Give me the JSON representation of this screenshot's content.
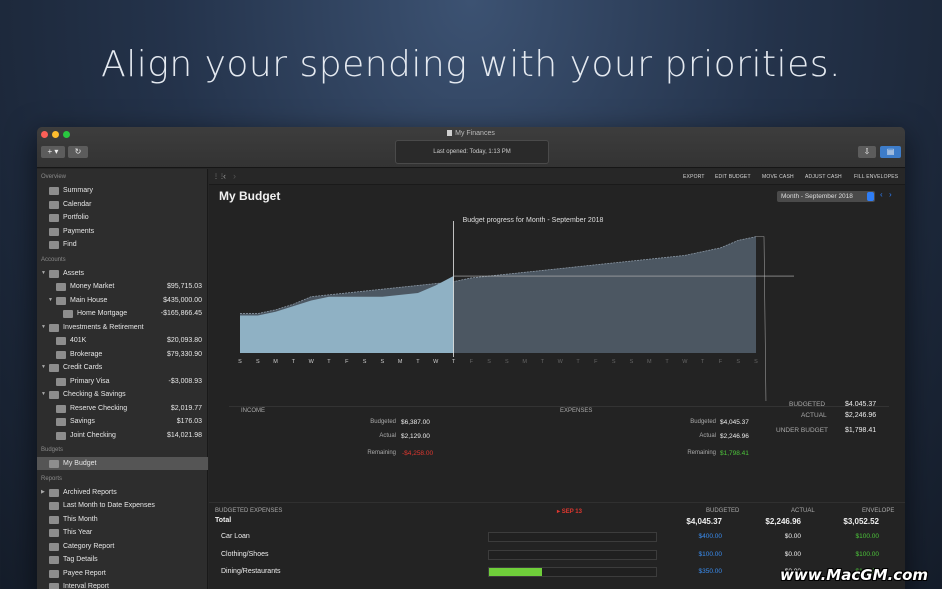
{
  "headline": "Align your spending with your priorities.",
  "window": {
    "title": "My Finances",
    "last_opened": "Last opened: Today, 1:13 PM",
    "add_button": "+ ▾",
    "refresh_button": "↻"
  },
  "sidebar": {
    "overview_label": "Overview",
    "overview": [
      {
        "label": "Summary",
        "icon": "summary-icon"
      },
      {
        "label": "Calendar",
        "icon": "calendar-icon"
      },
      {
        "label": "Portfolio",
        "icon": "portfolio-icon"
      },
      {
        "label": "Payments",
        "icon": "payments-icon"
      },
      {
        "label": "Find",
        "icon": "find-icon"
      }
    ],
    "accounts_label": "Accounts",
    "accounts": [
      {
        "label": "Assets",
        "amount": "",
        "indent": 1,
        "group": true
      },
      {
        "label": "Money Market",
        "amount": "$95,715.03",
        "indent": 2
      },
      {
        "label": "Main House",
        "amount": "$435,000.00",
        "indent": 2,
        "group": true
      },
      {
        "label": "Home Mortgage",
        "amount": "-$165,866.45",
        "indent": 3
      },
      {
        "label": "Investments & Retirement",
        "amount": "",
        "indent": 1,
        "group": true
      },
      {
        "label": "401K",
        "amount": "$20,093.80",
        "indent": 2
      },
      {
        "label": "Brokerage",
        "amount": "$79,330.90",
        "indent": 2
      },
      {
        "label": "Credit Cards",
        "amount": "",
        "indent": 1,
        "group": true
      },
      {
        "label": "Primary Visa",
        "amount": "-$3,008.93",
        "indent": 2
      },
      {
        "label": "Checking & Savings",
        "amount": "",
        "indent": 1,
        "group": true
      },
      {
        "label": "Reserve Checking",
        "amount": "$2,019.77",
        "indent": 2
      },
      {
        "label": "Savings",
        "amount": "$176.03",
        "indent": 2
      },
      {
        "label": "Joint Checking",
        "amount": "$14,021.98",
        "indent": 2
      }
    ],
    "budgets_label": "Budgets",
    "budgets": [
      {
        "label": "My Budget"
      }
    ],
    "reports_label": "Reports",
    "reports": [
      {
        "label": "Archived Reports",
        "group": true
      },
      {
        "label": "Last Month to Date Expenses"
      },
      {
        "label": "This Month"
      },
      {
        "label": "This Year"
      },
      {
        "label": "Category Report"
      },
      {
        "label": "Tag Details"
      },
      {
        "label": "Payee Report"
      },
      {
        "label": "Interval Report"
      }
    ]
  },
  "toolbar": {
    "export": "EXPORT",
    "edit_budget": "EDIT BUDGET",
    "move_cash": "MOVE CASH",
    "adjust_cash": "ADJUST CASH",
    "fill_envelopes": "FILL ENVELOPES"
  },
  "budget": {
    "title": "My Budget",
    "period": "Month - September 2018",
    "summary": {
      "budgeted_label": "BUDGETED",
      "budgeted": "$4,045.37",
      "actual_label": "ACTUAL",
      "actual": "$2,246.96",
      "under_label": "UNDER BUDGET",
      "under": "$1,798.41"
    },
    "income": {
      "label": "INCOME",
      "budgeted_label": "Budgeted",
      "budgeted": "$6,387.00",
      "actual_label": "Actual",
      "actual": "$2,129.00",
      "remaining_label": "Remaining",
      "remaining": "-$4,258.00"
    },
    "expenses": {
      "label": "EXPENSES",
      "budgeted_label": "Budgeted",
      "budgeted": "$4,045.37",
      "actual_label": "Actual",
      "actual": "$2,246.96",
      "remaining_label": "Remaining",
      "remaining": "$1,798.41"
    },
    "table": {
      "header": "BUDGETED EXPENSES",
      "date_marker": "SEP 13",
      "col_budgeted": "BUDGETED",
      "col_actual": "ACTUAL",
      "col_envelope": "ENVELOPE",
      "rows": [
        {
          "label": "Total",
          "budgeted": "$4,045.37",
          "actual": "$2,246.96",
          "envelope": "$3,052.52",
          "progress": null
        },
        {
          "label": "Car Loan",
          "budgeted": "$400.00",
          "actual": "$0.00",
          "envelope": "$100.00",
          "progress": 0
        },
        {
          "label": "Clothing/Shoes",
          "budgeted": "$100.00",
          "actual": "$0.00",
          "envelope": "$100.00",
          "progress": 0
        },
        {
          "label": "Dining/Restaurants",
          "budgeted": "$350.00",
          "actual": "$0.00",
          "envelope": "$100.00",
          "progress": 0.32
        }
      ]
    }
  },
  "chart_data": {
    "type": "area",
    "title": "Budget progress for Month - September 2018",
    "x": [
      "S",
      "S",
      "M",
      "T",
      "W",
      "T",
      "F",
      "S",
      "S",
      "M",
      "T",
      "W",
      "T",
      "F",
      "S",
      "S",
      "M",
      "T",
      "W",
      "T",
      "F",
      "S",
      "S",
      "M",
      "T",
      "W",
      "T",
      "F",
      "S",
      "S"
    ],
    "today_index": 12,
    "series": [
      {
        "name": "BUDGETED",
        "values": [
          210,
          210,
          230,
          260,
          300,
          310,
          320,
          330,
          340,
          350,
          360,
          370,
          380,
          400,
          410,
          420,
          430,
          440,
          450,
          460,
          470,
          480,
          490,
          500,
          510,
          520,
          540,
          560,
          600,
          620
        ]
      },
      {
        "name": "ACTUAL",
        "values": [
          200,
          200,
          220,
          250,
          280,
          300,
          300,
          300,
          300,
          310,
          320,
          360,
          410
        ]
      }
    ],
    "ylim": [
      0,
      650
    ],
    "colors": {
      "budgeted": "#53606d",
      "actual": "#8fb1c4"
    }
  },
  "watermark": "www.MacGM.com"
}
